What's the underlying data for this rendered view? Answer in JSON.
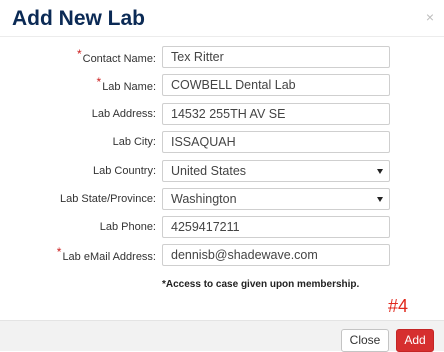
{
  "modal": {
    "title": "Add New Lab",
    "close_glyph": "×"
  },
  "form": {
    "fields": [
      {
        "label": "Contact Name:",
        "required": true,
        "value": "Tex Ritter"
      },
      {
        "label": "Lab Name:",
        "required": true,
        "value": "COWBELL Dental Lab"
      },
      {
        "label": "Lab Address:",
        "required": false,
        "value": "14532 255TH AV SE"
      },
      {
        "label": "Lab City:",
        "required": false,
        "value": "ISSAQUAH"
      },
      {
        "label": "Lab Country:",
        "required": false,
        "value": "United States"
      },
      {
        "label": "Lab State/Province:",
        "required": false,
        "value": "Washington"
      },
      {
        "label": "Lab Phone:",
        "required": false,
        "value": "4259417211"
      },
      {
        "label": "Lab eMail Address:",
        "required": true,
        "value": "dennisb@shadewave.com"
      }
    ],
    "required_marker": "*",
    "note": "*Access to case given upon membership."
  },
  "annotation": {
    "step_label": "#4",
    "color": "#e0281c"
  },
  "footer": {
    "close_label": "Close",
    "add_label": "Add"
  },
  "colors": {
    "title": "#0b2a55",
    "required": "#cc1f1f",
    "add_button": "#d62f2f"
  },
  "icons": {
    "close": "close-icon",
    "dropdown": "caret-down-icon"
  }
}
